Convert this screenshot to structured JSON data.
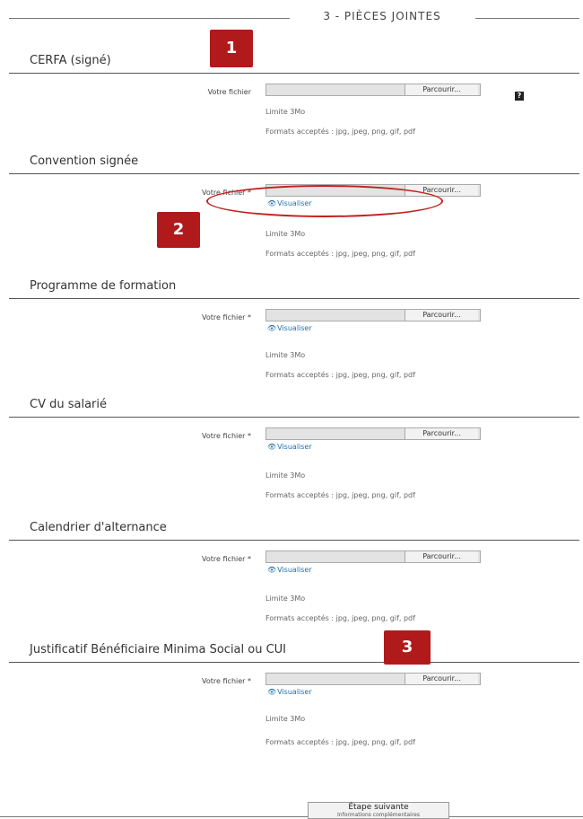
{
  "header": {
    "title": "3 - PIÈCES JOINTES"
  },
  "sections": [
    {
      "title": "CERFA (signé)",
      "field_label": "Votre fichier",
      "browse_label": "Parcourir...",
      "has_visualize": false,
      "visualize_label": "",
      "limit": "Limite 3Mo",
      "formats": "Formats acceptés : jpg, jpeg, png, gif, pdf"
    },
    {
      "title": "Convention signée",
      "field_label": "Votre fichier *",
      "browse_label": "Parcourir...",
      "has_visualize": true,
      "visualize_label": "Visualiser",
      "limit": "Limite 3Mo",
      "formats": "Formats acceptés : jpg, jpeg, png, gif, pdf"
    },
    {
      "title": "Programme de formation",
      "field_label": "Votre fichier *",
      "browse_label": "Parcourir...",
      "has_visualize": true,
      "visualize_label": "Visualiser",
      "limit": "Limite 3Mo",
      "formats": "Formats acceptés : jpg, jpeg, png, gif, pdf"
    },
    {
      "title": "CV du salarié",
      "field_label": "Votre fichier *",
      "browse_label": "Parcourir...",
      "has_visualize": true,
      "visualize_label": "Visualiser",
      "limit": "Limite 3Mo",
      "formats": "Formats acceptés : jpg, jpeg, png, gif, pdf"
    },
    {
      "title": "Calendrier d'alternance",
      "field_label": "Votre fichier *",
      "browse_label": "Parcourir...",
      "has_visualize": true,
      "visualize_label": "Visualiser",
      "limit": "Limite 3Mo",
      "formats": "Formats acceptés : jpg, jpeg, png, gif, pdf"
    },
    {
      "title": "Justificatif Bénéficiaire Minima Social ou CUI",
      "field_label": "Votre fichier *",
      "browse_label": "Parcourir...",
      "has_visualize": true,
      "visualize_label": "Visualiser",
      "limit": "Limite 3Mo",
      "formats": "Formats acceptés : jpg, jpeg, png, gif, pdf"
    }
  ],
  "help_icon": {
    "glyph": "?",
    "icon": "help-icon"
  },
  "annotations": {
    "badge1": "1",
    "badge2": "2",
    "badge3": "3",
    "badge_color": "#b11a1a",
    "ellipse_color": "#c42020"
  },
  "footer": {
    "next_label": "Étape suivante",
    "next_sublabel": "Informations complémentaires"
  }
}
